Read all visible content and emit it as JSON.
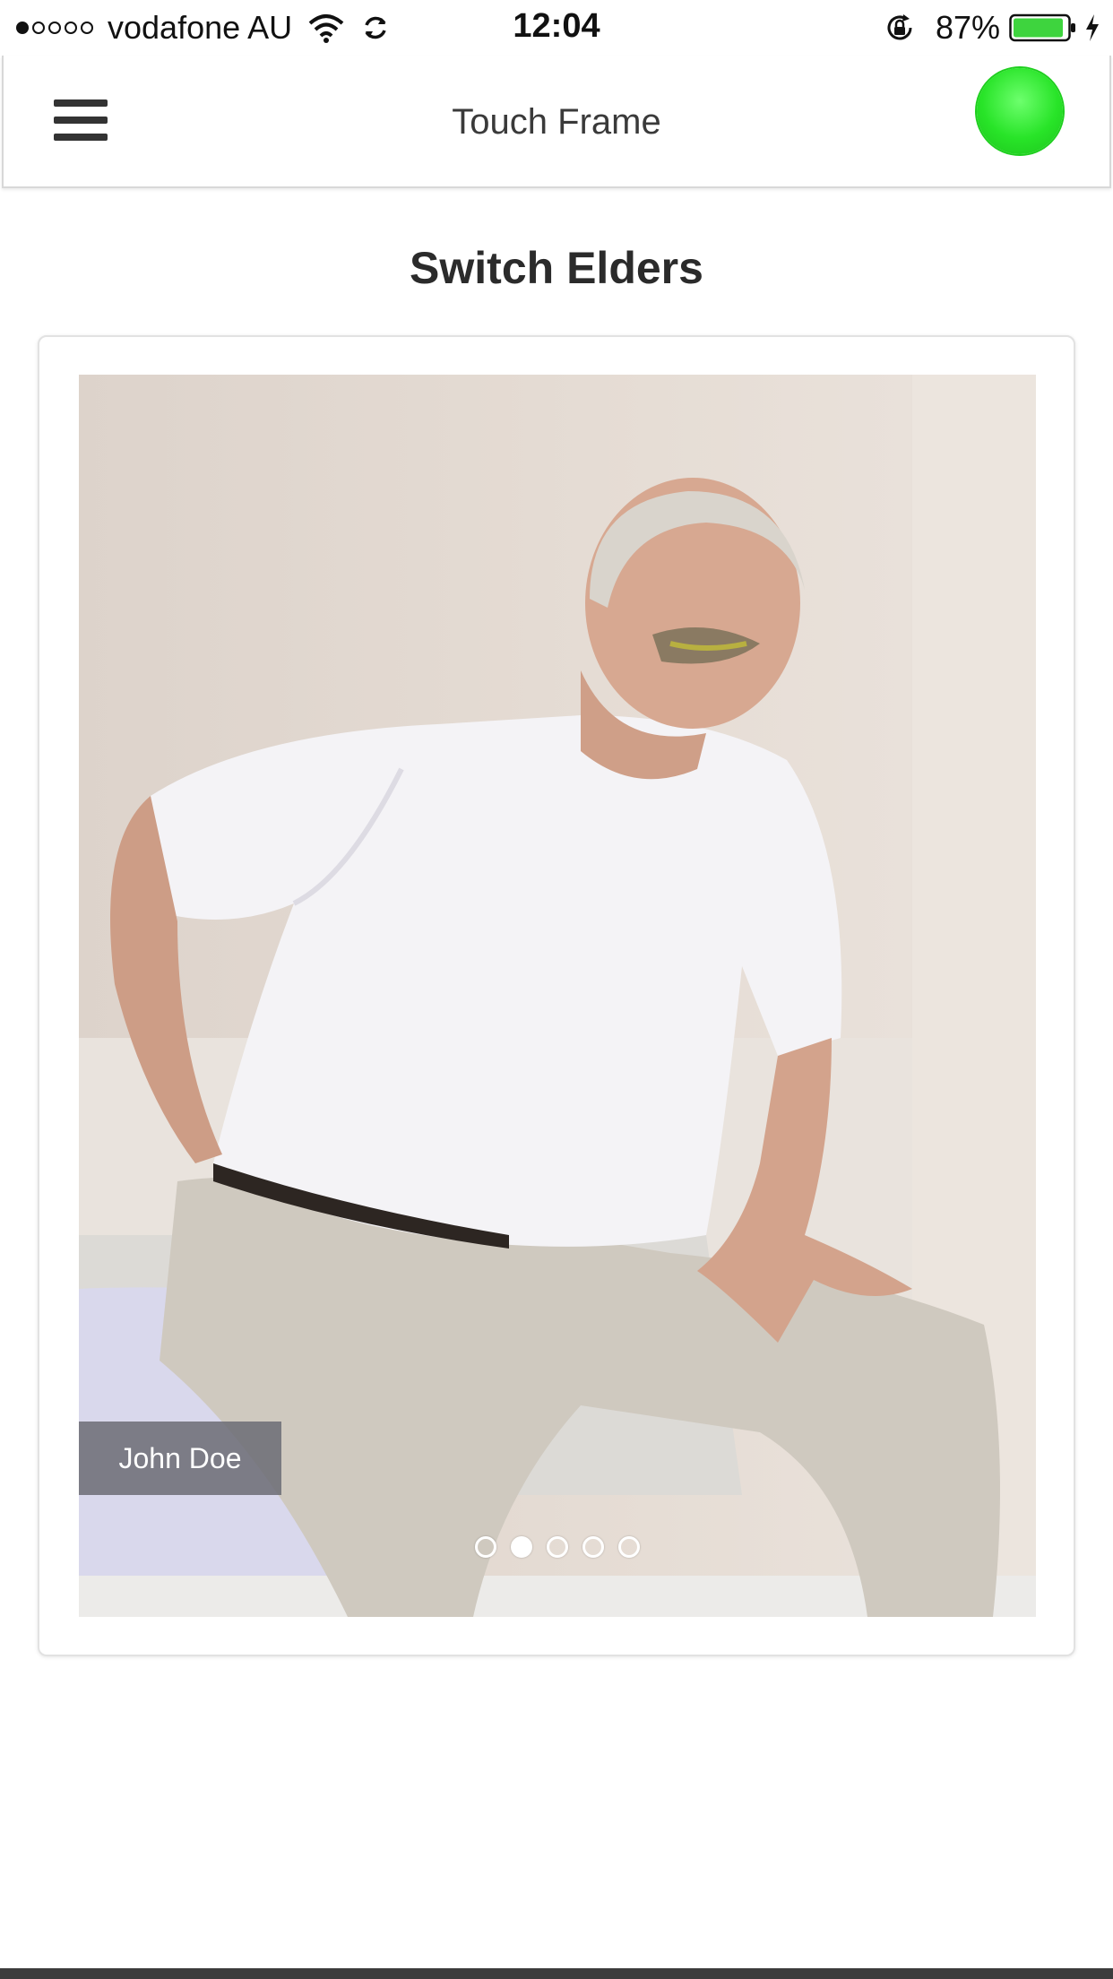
{
  "status_bar": {
    "carrier": "vodafone AU",
    "time": "12:04",
    "battery_percent": "87%",
    "signal_bars": 1,
    "signal_total": 5,
    "icons": [
      "wifi-icon",
      "sync-icon",
      "rotation-lock-icon",
      "battery-icon",
      "charging-bolt-icon"
    ]
  },
  "nav": {
    "title": "Touch Frame",
    "menu_icon": "hamburger-menu-icon",
    "status_indicator_color": "#28e428"
  },
  "page": {
    "title": "Switch Elders"
  },
  "carousel": {
    "current_name": "John Doe",
    "slide_count": 5,
    "active_index": 1
  },
  "colors": {
    "accent_green": "#28e428",
    "name_tag_bg": "#6e6e78"
  }
}
